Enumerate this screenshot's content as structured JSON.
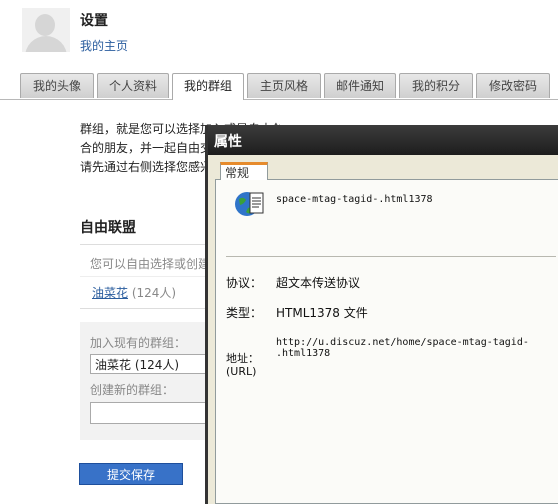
{
  "header": {
    "title": "设置",
    "home_link": "我的主页"
  },
  "tabs": [
    {
      "label": "我的头像"
    },
    {
      "label": "个人资料"
    },
    {
      "label": "我的群组",
      "active": true
    },
    {
      "label": "主页风格"
    },
    {
      "label": "邮件通知"
    },
    {
      "label": "我的积分"
    },
    {
      "label": "修改密码"
    }
  ],
  "content": {
    "desc_line1": "群组，就是您可以选择加入或是自由创建的交流圈。通过群组，您可以找到志同道",
    "desc_line2": "合的朋友，并一起自由交",
    "desc_line3": "请先通过右侧选择您感兴",
    "section_title": "自由联盟",
    "hint": "您可以自由选择或创建",
    "group_name": "油菜花",
    "group_count": "(124人)",
    "join_label": "加入现有的群组：",
    "join_selected": "油菜花 (124人)",
    "create_label": "创建新的群组：",
    "create_value": "",
    "submit_label": "提交保存"
  },
  "dialog": {
    "title": "属性",
    "tab": "常规",
    "filename": "space-mtag-tagid-.html1378",
    "protocol_label": "协议：",
    "protocol_value": "超文本传送协议",
    "type_label": "类型：",
    "type_value": "HTML1378 文件",
    "address_label": "地址：",
    "address_label_en": "(URL)",
    "address_line1": "http://u.discuz.net/home/space-mtag-tagid-",
    "address_line2": ".html1378",
    "icon": "html-document-icon"
  }
}
